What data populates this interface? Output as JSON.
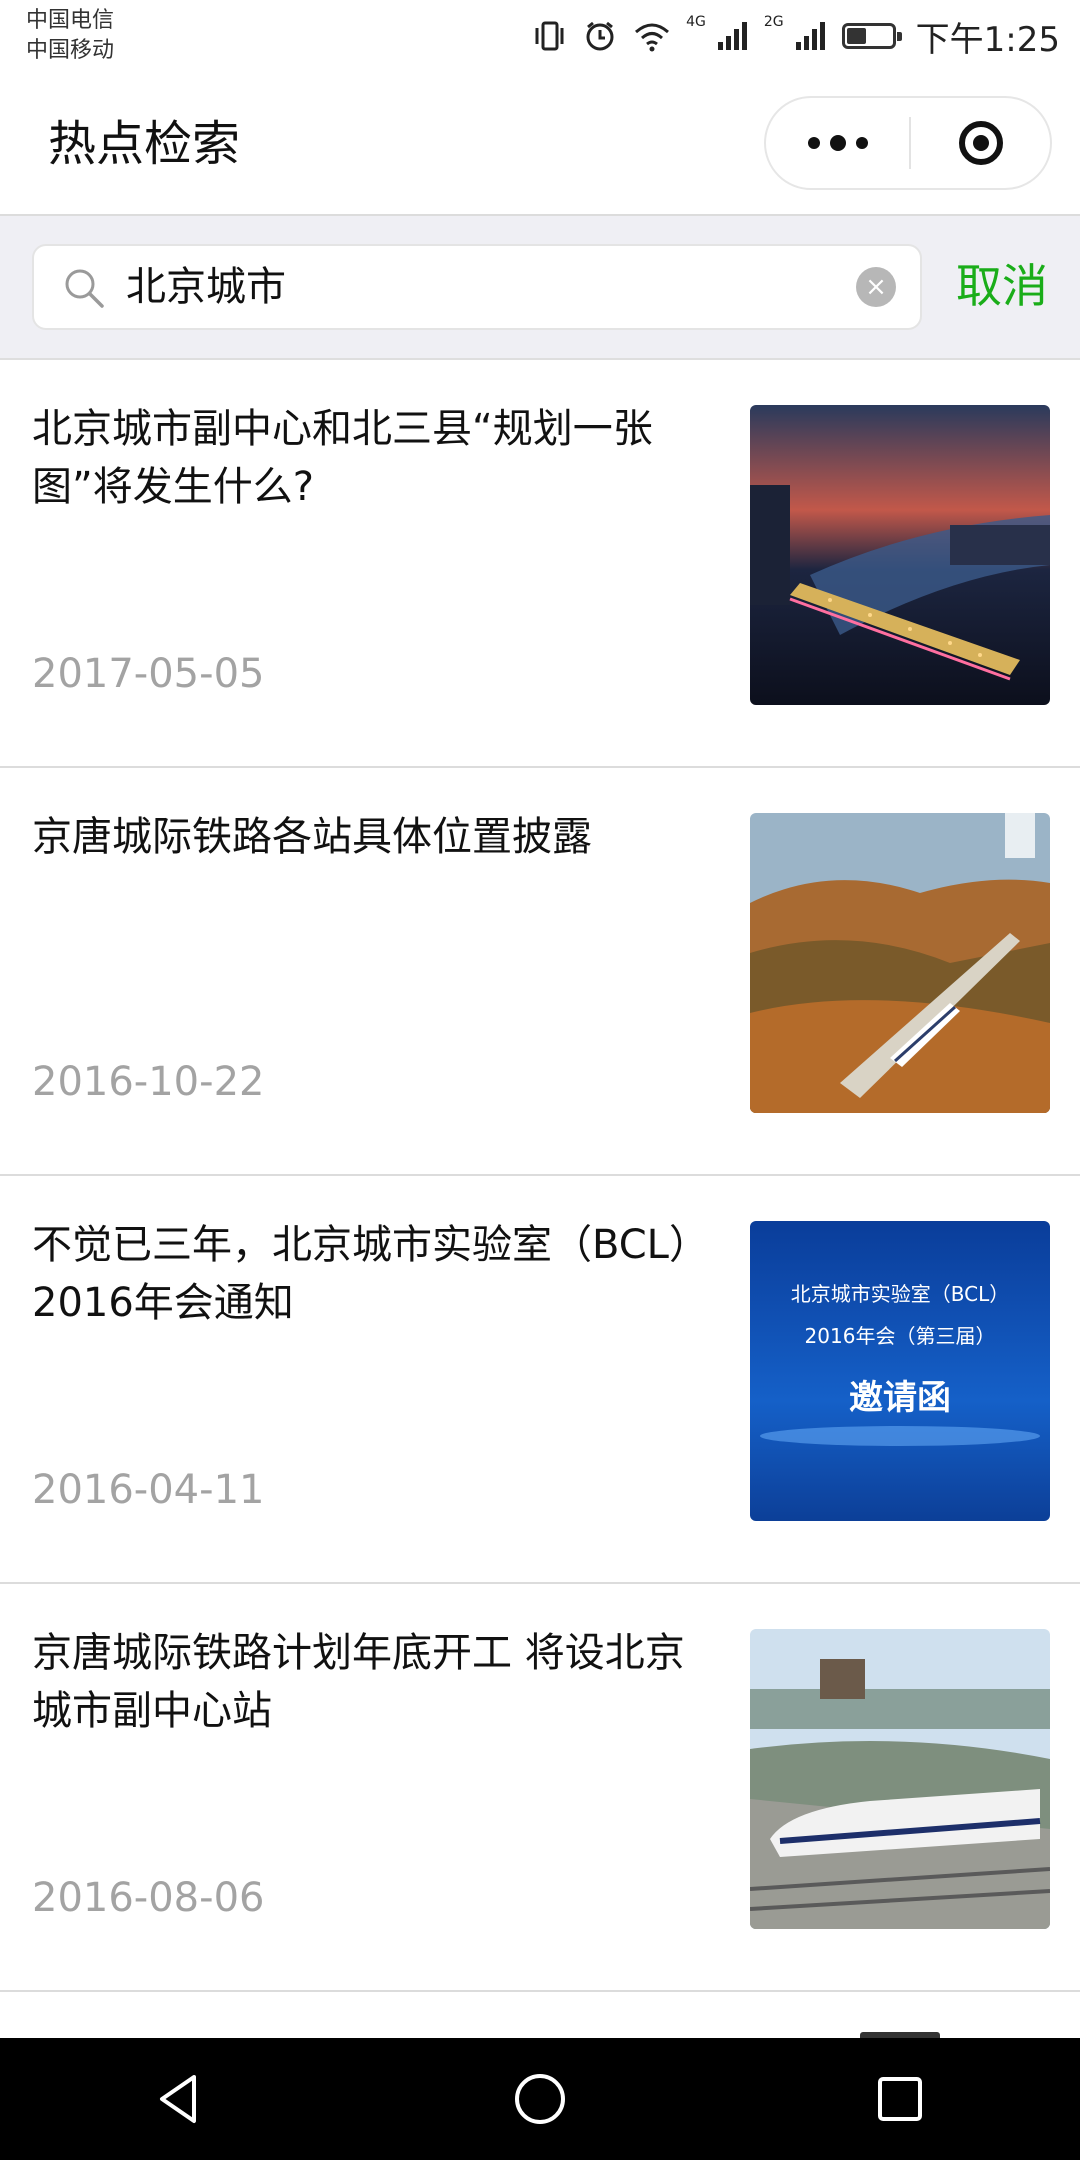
{
  "status_bar": {
    "carrier_1": "中国电信",
    "carrier_2": "中国移动",
    "net_1": "4G",
    "net_2": "2G",
    "battery_level": 0.45,
    "time": "下午1:25"
  },
  "header": {
    "title": "热点检索",
    "more_icon": "more-dots-icon",
    "close_icon": "target-close-icon"
  },
  "search": {
    "value": "北京城市",
    "cancel_label": "取消",
    "search_icon": "search-icon",
    "clear_icon": "clear-icon"
  },
  "results": [
    {
      "title": "北京城市副中心和北三县“规划一张图”将发生什么?",
      "date": "2017-05-05",
      "thumbnail": "night-city-bridge"
    },
    {
      "title": "京唐城际铁路各站具体位置披露",
      "date": "2016-10-22",
      "thumbnail": "train-autumn-hills"
    },
    {
      "title": "不觉已三年，北京城市实验室（BCL）2016年会通知",
      "date": "2016-04-11",
      "thumbnail": "bcl-invitation-blue"
    },
    {
      "title": "京唐城际铁路计划年底开工 将设北京城市副中心站",
      "date": "2016-08-06",
      "thumbnail": "bullet-train-city"
    }
  ],
  "thumb_text": {
    "bcl_line1": "北京城市实验室（BCL）",
    "bcl_line2": "2016年会（第三届）",
    "bcl_line3": "邀请函"
  },
  "colors": {
    "accent": "#1aad19",
    "date_gray": "#a3a3a3",
    "search_bg": "#efeff4"
  }
}
